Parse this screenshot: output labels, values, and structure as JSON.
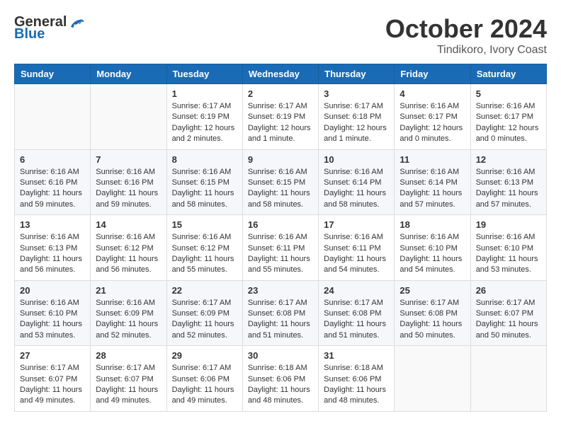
{
  "logo": {
    "general": "General",
    "blue": "Blue"
  },
  "header": {
    "month": "October 2024",
    "location": "Tindikoro, Ivory Coast"
  },
  "weekdays": [
    "Sunday",
    "Monday",
    "Tuesday",
    "Wednesday",
    "Thursday",
    "Friday",
    "Saturday"
  ],
  "weeks": [
    [
      {
        "day": "",
        "detail": ""
      },
      {
        "day": "",
        "detail": ""
      },
      {
        "day": "1",
        "detail": "Sunrise: 6:17 AM\nSunset: 6:19 PM\nDaylight: 12 hours\nand 2 minutes."
      },
      {
        "day": "2",
        "detail": "Sunrise: 6:17 AM\nSunset: 6:19 PM\nDaylight: 12 hours\nand 1 minute."
      },
      {
        "day": "3",
        "detail": "Sunrise: 6:17 AM\nSunset: 6:18 PM\nDaylight: 12 hours\nand 1 minute."
      },
      {
        "day": "4",
        "detail": "Sunrise: 6:16 AM\nSunset: 6:17 PM\nDaylight: 12 hours\nand 0 minutes."
      },
      {
        "day": "5",
        "detail": "Sunrise: 6:16 AM\nSunset: 6:17 PM\nDaylight: 12 hours\nand 0 minutes."
      }
    ],
    [
      {
        "day": "6",
        "detail": "Sunrise: 6:16 AM\nSunset: 6:16 PM\nDaylight: 11 hours\nand 59 minutes."
      },
      {
        "day": "7",
        "detail": "Sunrise: 6:16 AM\nSunset: 6:16 PM\nDaylight: 11 hours\nand 59 minutes."
      },
      {
        "day": "8",
        "detail": "Sunrise: 6:16 AM\nSunset: 6:15 PM\nDaylight: 11 hours\nand 58 minutes."
      },
      {
        "day": "9",
        "detail": "Sunrise: 6:16 AM\nSunset: 6:15 PM\nDaylight: 11 hours\nand 58 minutes."
      },
      {
        "day": "10",
        "detail": "Sunrise: 6:16 AM\nSunset: 6:14 PM\nDaylight: 11 hours\nand 58 minutes."
      },
      {
        "day": "11",
        "detail": "Sunrise: 6:16 AM\nSunset: 6:14 PM\nDaylight: 11 hours\nand 57 minutes."
      },
      {
        "day": "12",
        "detail": "Sunrise: 6:16 AM\nSunset: 6:13 PM\nDaylight: 11 hours\nand 57 minutes."
      }
    ],
    [
      {
        "day": "13",
        "detail": "Sunrise: 6:16 AM\nSunset: 6:13 PM\nDaylight: 11 hours\nand 56 minutes."
      },
      {
        "day": "14",
        "detail": "Sunrise: 6:16 AM\nSunset: 6:12 PM\nDaylight: 11 hours\nand 56 minutes."
      },
      {
        "day": "15",
        "detail": "Sunrise: 6:16 AM\nSunset: 6:12 PM\nDaylight: 11 hours\nand 55 minutes."
      },
      {
        "day": "16",
        "detail": "Sunrise: 6:16 AM\nSunset: 6:11 PM\nDaylight: 11 hours\nand 55 minutes."
      },
      {
        "day": "17",
        "detail": "Sunrise: 6:16 AM\nSunset: 6:11 PM\nDaylight: 11 hours\nand 54 minutes."
      },
      {
        "day": "18",
        "detail": "Sunrise: 6:16 AM\nSunset: 6:10 PM\nDaylight: 11 hours\nand 54 minutes."
      },
      {
        "day": "19",
        "detail": "Sunrise: 6:16 AM\nSunset: 6:10 PM\nDaylight: 11 hours\nand 53 minutes."
      }
    ],
    [
      {
        "day": "20",
        "detail": "Sunrise: 6:16 AM\nSunset: 6:10 PM\nDaylight: 11 hours\nand 53 minutes."
      },
      {
        "day": "21",
        "detail": "Sunrise: 6:16 AM\nSunset: 6:09 PM\nDaylight: 11 hours\nand 52 minutes."
      },
      {
        "day": "22",
        "detail": "Sunrise: 6:17 AM\nSunset: 6:09 PM\nDaylight: 11 hours\nand 52 minutes."
      },
      {
        "day": "23",
        "detail": "Sunrise: 6:17 AM\nSunset: 6:08 PM\nDaylight: 11 hours\nand 51 minutes."
      },
      {
        "day": "24",
        "detail": "Sunrise: 6:17 AM\nSunset: 6:08 PM\nDaylight: 11 hours\nand 51 minutes."
      },
      {
        "day": "25",
        "detail": "Sunrise: 6:17 AM\nSunset: 6:08 PM\nDaylight: 11 hours\nand 50 minutes."
      },
      {
        "day": "26",
        "detail": "Sunrise: 6:17 AM\nSunset: 6:07 PM\nDaylight: 11 hours\nand 50 minutes."
      }
    ],
    [
      {
        "day": "27",
        "detail": "Sunrise: 6:17 AM\nSunset: 6:07 PM\nDaylight: 11 hours\nand 49 minutes."
      },
      {
        "day": "28",
        "detail": "Sunrise: 6:17 AM\nSunset: 6:07 PM\nDaylight: 11 hours\nand 49 minutes."
      },
      {
        "day": "29",
        "detail": "Sunrise: 6:17 AM\nSunset: 6:06 PM\nDaylight: 11 hours\nand 49 minutes."
      },
      {
        "day": "30",
        "detail": "Sunrise: 6:18 AM\nSunset: 6:06 PM\nDaylight: 11 hours\nand 48 minutes."
      },
      {
        "day": "31",
        "detail": "Sunrise: 6:18 AM\nSunset: 6:06 PM\nDaylight: 11 hours\nand 48 minutes."
      },
      {
        "day": "",
        "detail": ""
      },
      {
        "day": "",
        "detail": ""
      }
    ]
  ]
}
